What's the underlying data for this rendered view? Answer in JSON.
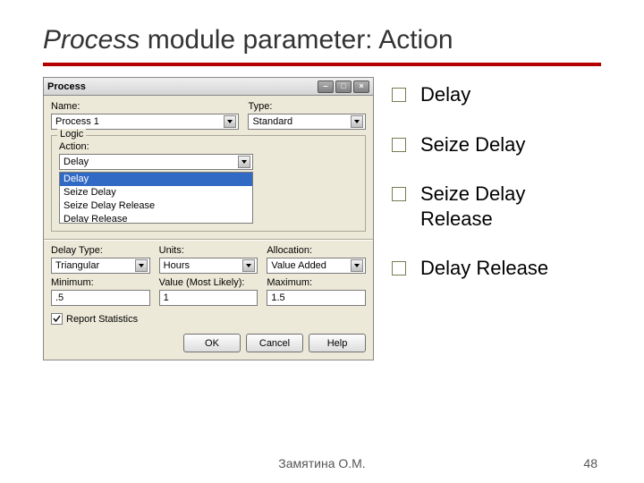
{
  "title": {
    "word1": "Process",
    "word2": " module ",
    "word3": "parameter: Action"
  },
  "dialog": {
    "title": "Process",
    "name": {
      "label": "Name:",
      "value": "Process 1"
    },
    "type": {
      "label": "Type:",
      "value": "Standard"
    },
    "logic": {
      "legend": "Logic",
      "action_label": "Action:",
      "action_value": "Delay",
      "options": [
        "Delay",
        "Seize Delay",
        "Seize Delay Release",
        "Delay Release"
      ]
    },
    "delay_type": {
      "label": "Delay Type:",
      "value": "Triangular"
    },
    "units": {
      "label": "Units:",
      "value": "Hours"
    },
    "allocation": {
      "label": "Allocation:",
      "value": "Value Added"
    },
    "minimum": {
      "label": "Minimum:",
      "value": ".5"
    },
    "most_likely": {
      "label": "Value (Most Likely):",
      "value": "1"
    },
    "maximum": {
      "label": "Maximum:",
      "value": "1.5"
    },
    "report_stats": "Report Statistics",
    "buttons": {
      "ok": "OK",
      "cancel": "Cancel",
      "help": "Help"
    }
  },
  "bullets": [
    "Delay",
    "Seize Delay",
    "Seize Delay Release",
    "Delay Release"
  ],
  "footer": {
    "author": "Замятина О.М.",
    "page": "48"
  }
}
